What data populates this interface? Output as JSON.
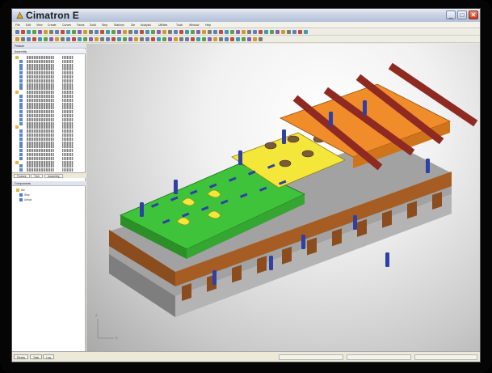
{
  "window": {
    "title": "Cimatron E",
    "minimize_glyph": "_",
    "maximize_glyph": "□",
    "close_glyph": "✕"
  },
  "menu": {
    "items": [
      "File",
      "Edit",
      "View",
      "Create",
      "Curves",
      "Faces",
      "Solid",
      "Strip",
      "Stations",
      "Die",
      "Analysis",
      "Utilities",
      "Tools",
      "Window",
      "Help"
    ]
  },
  "left_panel": {
    "header_label": "Feature",
    "assembly_header": "Assembly",
    "tabs": [
      "Feature",
      "Tree",
      "Assembly"
    ],
    "lower_header": "Components",
    "lower_items": [
      "Die",
      "Strip",
      "Unfold"
    ]
  },
  "viewport": {
    "axis_x_label": "X",
    "axis_y_label": "Y",
    "axis_z_label": "Z"
  },
  "status": {
    "tabs": [
      "Ready",
      "Task",
      "Log"
    ]
  },
  "colors": {
    "strip_green": "#3fc33a",
    "strip_yellow": "#f5e63a",
    "punch_orange": "#f08c2a",
    "rail_brown": "#8e2a22",
    "pin_blue": "#2e3fa6",
    "base_gray": "#a9a9a9",
    "base_brown": "#8b4d1e"
  },
  "icons": [
    "app-logo-icon",
    "minimize-icon",
    "maximize-icon",
    "close-icon",
    "folder-icon",
    "component-icon",
    "axis-icon"
  ]
}
